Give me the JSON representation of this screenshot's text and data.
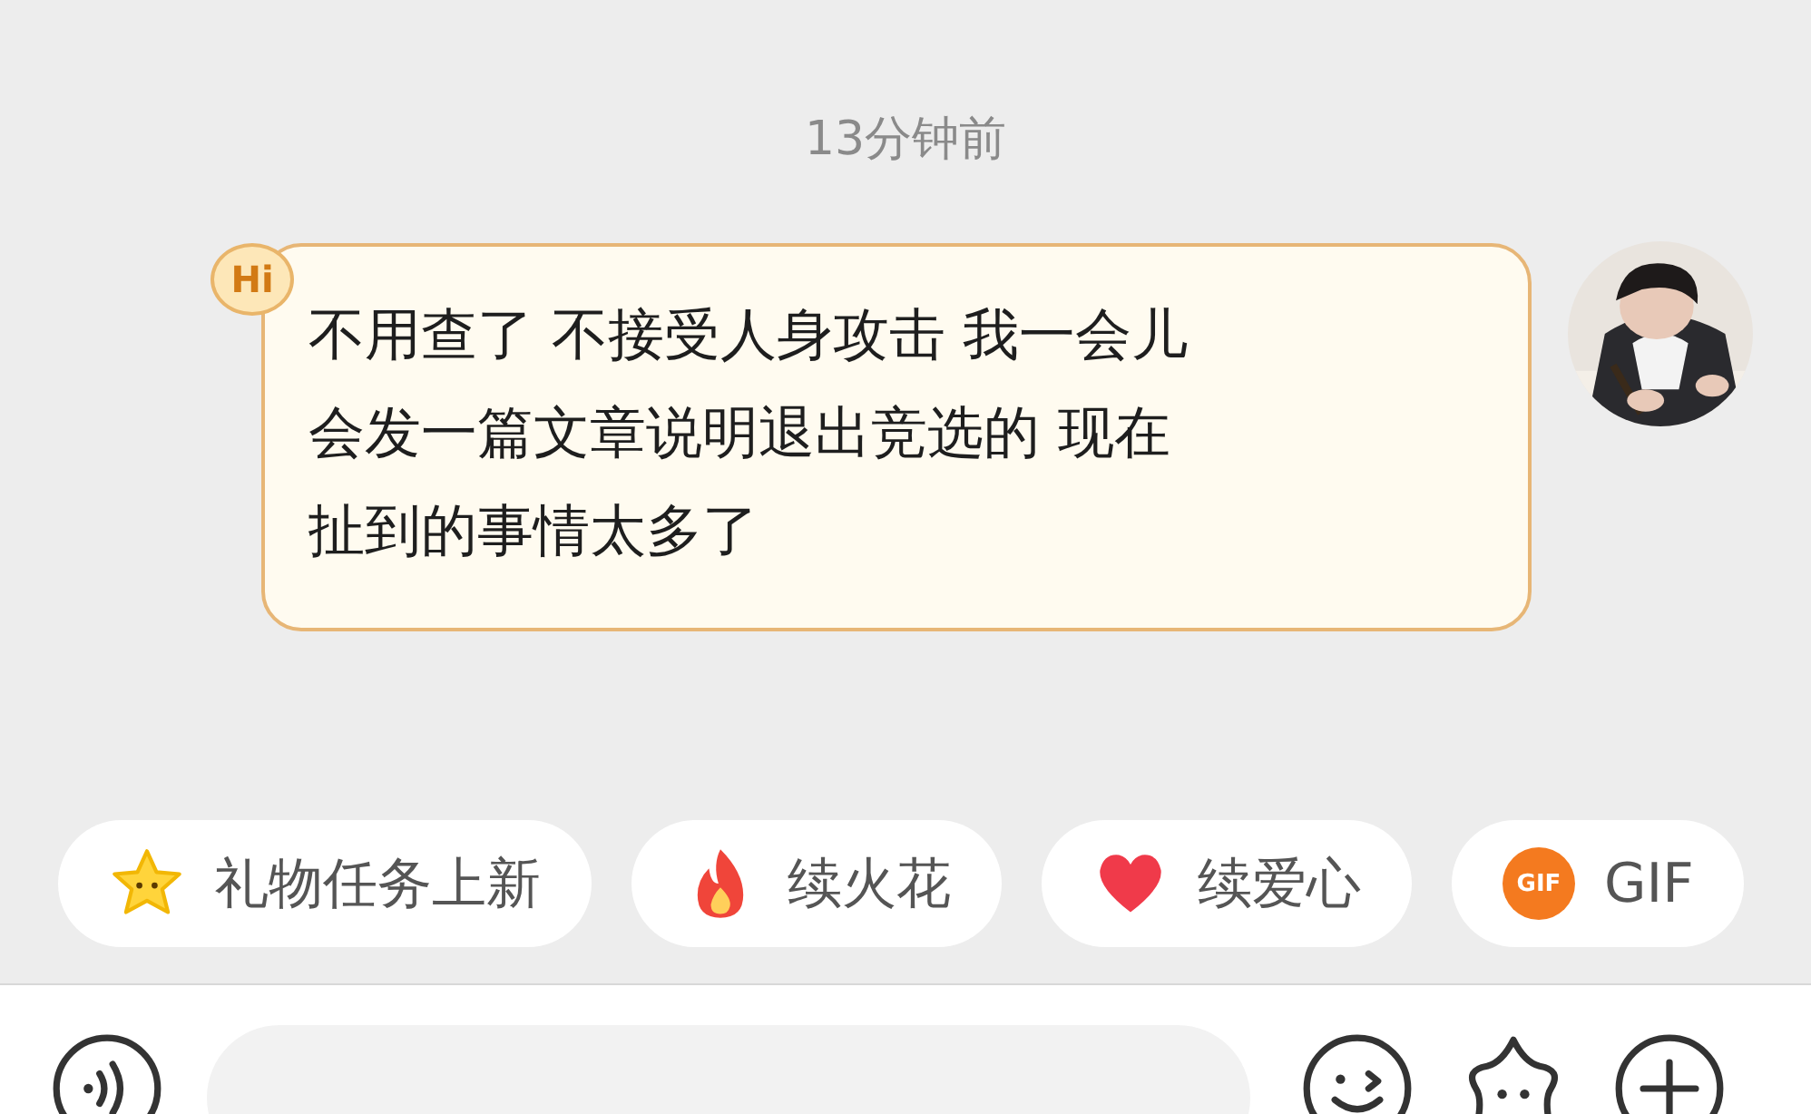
{
  "timestamp": "13分钟前",
  "message": {
    "badge": "Hi",
    "lines": [
      "不用查了 不接受人身攻击 我一会儿",
      "会发一篇文章说明退出竞选的 现在",
      "扯到的事情太多了"
    ],
    "avatar": {
      "kind": "picture"
    }
  },
  "quick_chips": [
    {
      "kind": "star",
      "label": "礼物任务上新"
    },
    {
      "kind": "flame",
      "label": "续火花"
    },
    {
      "kind": "heart",
      "label": "续爱心"
    },
    {
      "kind": "gif",
      "badge": "GIF",
      "label": "GIF"
    }
  ]
}
